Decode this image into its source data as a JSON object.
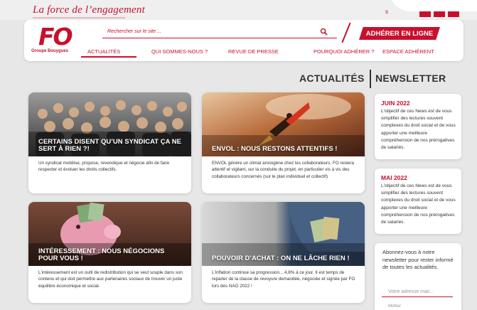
{
  "brand": {
    "tagline": "La force de l’engagement",
    "logo_text": "FO",
    "logo_sub": "Groupe Bouygues",
    "top_right_letter": "s",
    "color": "#c8102e"
  },
  "header": {
    "search_placeholder": "Rechercher sur le site ...",
    "join_label": "ADHÉRER EN LIGNE",
    "nav": [
      "ACTUALITÉS",
      "QUI SOMMES-NOUS ?",
      "REVUE DE PRESSE",
      "POURQUOI ADHÉRER ?",
      "ESPACE ADHÉRENT"
    ],
    "active_nav": "ACTUALITÉS"
  },
  "sections": {
    "actualites": "ACTUALITÉS",
    "newsletter": "NEWSLETTER"
  },
  "articles": [
    {
      "title": "CERTAINS DISENT QU’UN SYNDICAT ÇA NE SERT À RIEN ?!",
      "excerpt": "Un syndicat mobilise, propose, revendique et négocie afin de faire respecter et évoluer les droits collectifs.",
      "image": "crowd-photo"
    },
    {
      "title": "ENVOL : NOUS RESTONS ATTENTIFS !",
      "excerpt": "ENVOL génère un climat anxiogène chez les collaborateurs. FO restera attentif et vigilant, sur la conduite du projet, en particulier vis à vis des collaborateurs concernés (sur le plan individuel et collectif)",
      "image": "rocket-photo"
    },
    {
      "title": "INTÉRESSEMENT : NOUS NÉGOCIONS POUR VOUS !",
      "excerpt": "L'intéressement est un outil de redistribution qui se veut souple dans son contenu et qui doit permettre aux partenaires sociaux de trouver un juste équilibre économique et social.",
      "image": "piggy-bank-photo"
    },
    {
      "title": "POUVOIR D’ACHAT : ON NE LÂCHE RIEN !",
      "excerpt": "L'inflation continue sa progression... 4,8% à ce jour. Il est temps de reparler de la clause de revoyure demandée, négociée et signée par FO lors des NAO 2022 !",
      "image": "jeans-pocket-money-photo"
    }
  ],
  "newsletters": [
    {
      "date": "JUIN 2022",
      "text": "L'objectif de ces News est de vous simplifier des lectures souvent complexes du droit social et de vous apporter une meilleure compréhension de nos prérogatives de salariés."
    },
    {
      "date": "MAI 2022",
      "text": "L'objectif de ces News est de vous simplifier des lectures souvent complexes du droit social et de vous apporter une meilleure compréhension de nos prérogatives de salariés."
    }
  ],
  "subscribe": {
    "text": "Abonnez-vous à notre newsletter pour rester informé de toutes les actualités.",
    "email_placeholder": "Votre adresse mail...",
    "extra": "Métier"
  }
}
